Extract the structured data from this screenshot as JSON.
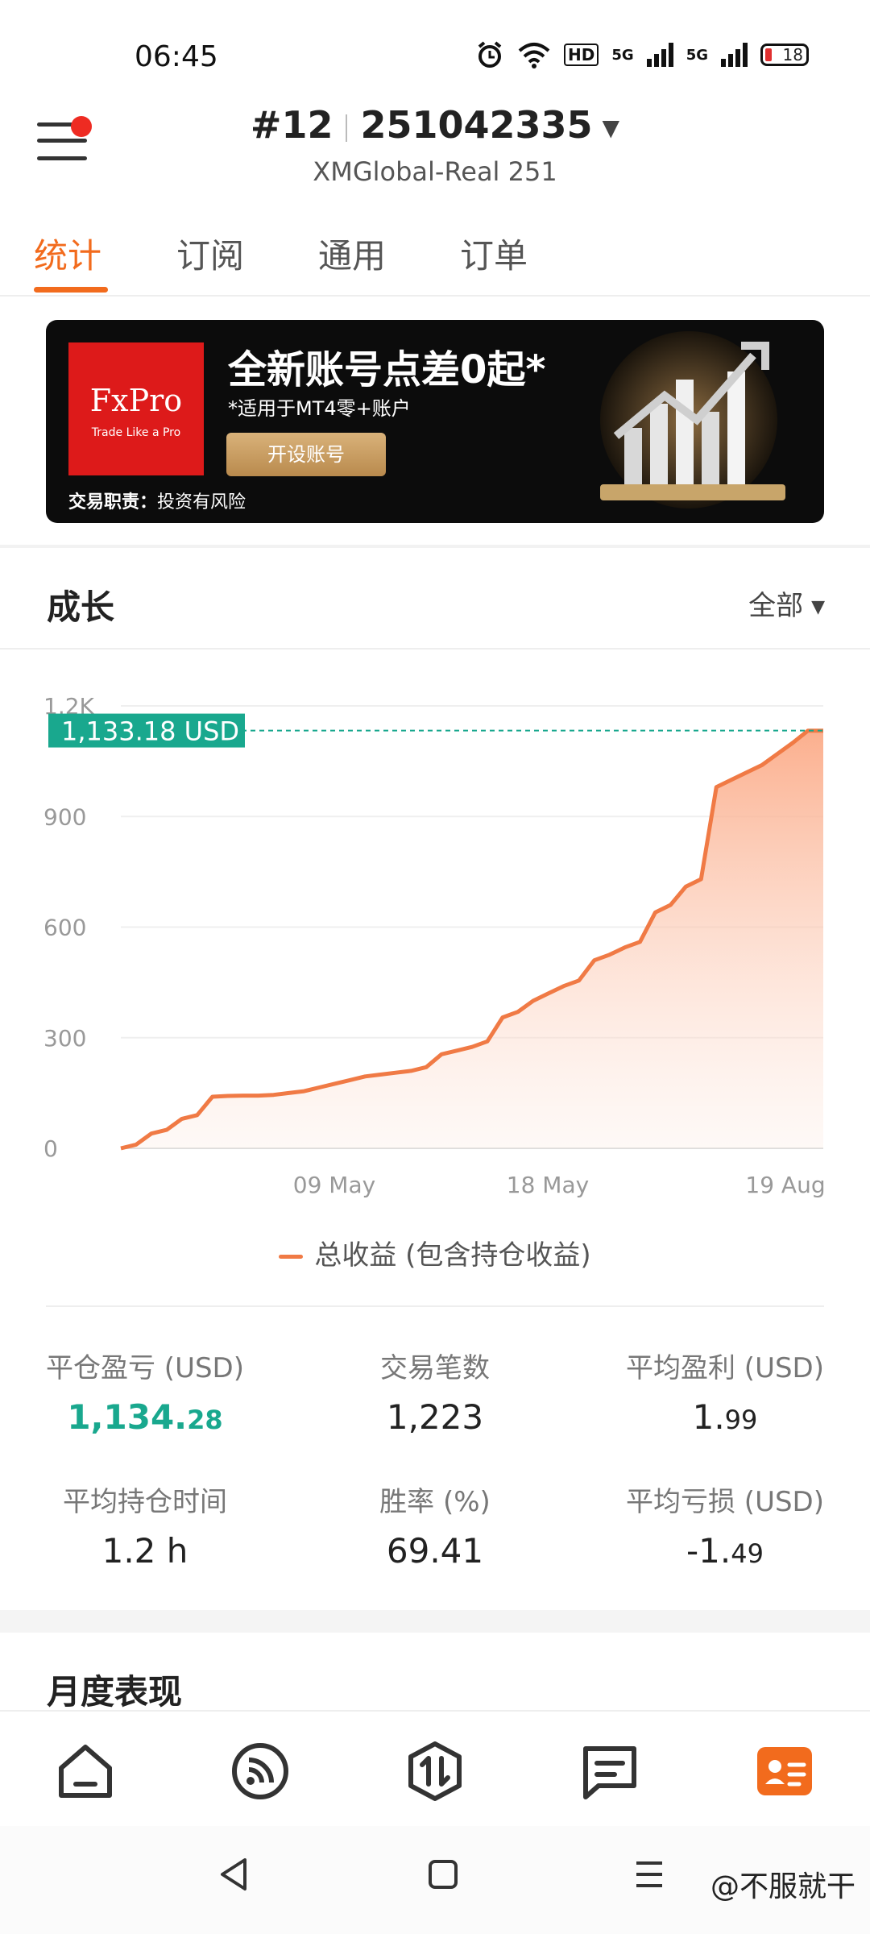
{
  "status_bar": {
    "time": "06:45",
    "hd_label": "HD",
    "net1": "5G",
    "net2": "5G",
    "battery": "18"
  },
  "header": {
    "account_num": "#12",
    "account_id": "251042335",
    "server": "XMGlobal-Real 251"
  },
  "tabs": [
    {
      "label": "统计",
      "active": true
    },
    {
      "label": "订阅",
      "active": false
    },
    {
      "label": "通用",
      "active": false
    },
    {
      "label": "订单",
      "active": false
    }
  ],
  "banner": {
    "logo_text": "FxPro",
    "logo_tagline": "Trade Like a Pro",
    "headline": "全新账号点差0起*",
    "subline": "*适用于MT4零+账户",
    "button": "开设账号",
    "risk_label": "交易职责：",
    "risk_text": "投资有风险"
  },
  "growth": {
    "title": "成长",
    "filter": "全部"
  },
  "chart_data": {
    "type": "area",
    "y_ticks": [
      "0",
      "300",
      "600",
      "900",
      "1.2K"
    ],
    "x_ticks": [
      "09 May",
      "18 May",
      "19 Aug"
    ],
    "ylim": [
      0,
      1200
    ],
    "current_label": "1,133.18 USD",
    "current_value": 1133.18,
    "series": [
      {
        "name": "总收益 (包含持仓收益)",
        "values": [
          0,
          10,
          40,
          50,
          80,
          90,
          140,
          142,
          143,
          143,
          145,
          150,
          155,
          165,
          175,
          185,
          195,
          200,
          205,
          210,
          220,
          255,
          265,
          275,
          290,
          355,
          370,
          400,
          420,
          440,
          455,
          510,
          525,
          545,
          560,
          640,
          660,
          710,
          730,
          980,
          1000,
          1020,
          1040,
          1070,
          1100,
          1133,
          1133
        ]
      }
    ],
    "colors": {
      "line": "#f07a45",
      "fill": "#fbb79a",
      "marker": "#19a88e"
    },
    "grid": true
  },
  "legend": {
    "label": "总收益 (包含持仓收益)"
  },
  "stats": [
    {
      "label": "平仓盈亏 (USD)",
      "value_main": "1,134.",
      "value_dec": "28",
      "positive": true
    },
    {
      "label": "交易笔数",
      "value_main": "1,223",
      "value_dec": ""
    },
    {
      "label": "平均盈利 (USD)",
      "value_main": "1.",
      "value_dec": "99"
    },
    {
      "label": "平均持仓时间",
      "value_main": "1.2 h",
      "value_dec": ""
    },
    {
      "label": "胜率 (%)",
      "value_main": "69.41",
      "value_dec": ""
    },
    {
      "label": "平均亏损 (USD)",
      "value_main": "-1.",
      "value_dec": "49"
    }
  ],
  "monthly": {
    "title": "月度表现"
  },
  "bottom_nav": [
    {
      "icon": "home-icon"
    },
    {
      "icon": "signal-feed-icon"
    },
    {
      "icon": "trade-icon"
    },
    {
      "icon": "chat-icon"
    },
    {
      "icon": "profile-card-icon",
      "active": true,
      "color": "#f26b1d"
    }
  ],
  "watermark": "@不服就干"
}
